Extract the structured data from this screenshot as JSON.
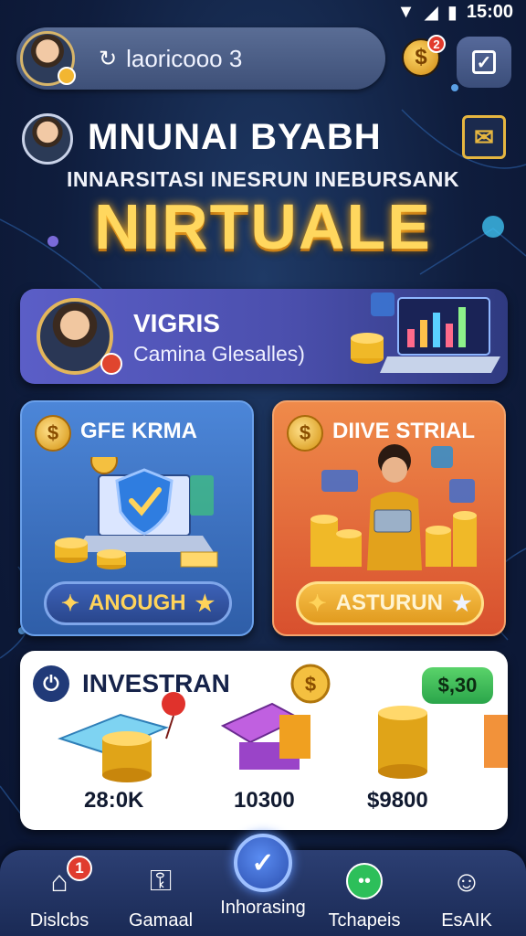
{
  "status_bar": {
    "time": "15:00"
  },
  "header": {
    "search_text": "laoricooo 3",
    "coin_badge": "2"
  },
  "hero": {
    "title": "MNUNAI BYABH",
    "subtitle": "INNARSITASI INESRUN INEBURSANK",
    "headline": "NIRTUALE"
  },
  "vigris_card": {
    "title": "VIGRIS",
    "subtitle": "Camina Glesalles)"
  },
  "cards": [
    {
      "title": "GFE KRMA",
      "button": "ANOUGH"
    },
    {
      "title": "DIIVE STRIAL",
      "button": "ASTURUN"
    }
  ],
  "invest": {
    "title": "INVESTRAN",
    "price_tag": "$,30",
    "stats": [
      "28:0K",
      "10300",
      "$9800"
    ]
  },
  "nav": {
    "items": [
      {
        "label": "Dislcbs",
        "badge": "1"
      },
      {
        "label": "Gamaal"
      },
      {
        "label": "Inhorasing"
      },
      {
        "label": "Tchapeis"
      },
      {
        "label": "EsAIK"
      }
    ]
  },
  "colors": {
    "background": "#0f1d3d",
    "accent_gold": "#ffd75e",
    "card_blue": "#4c86d8",
    "card_orange": "#ef8a4a",
    "badge_red": "#e03c2f"
  }
}
